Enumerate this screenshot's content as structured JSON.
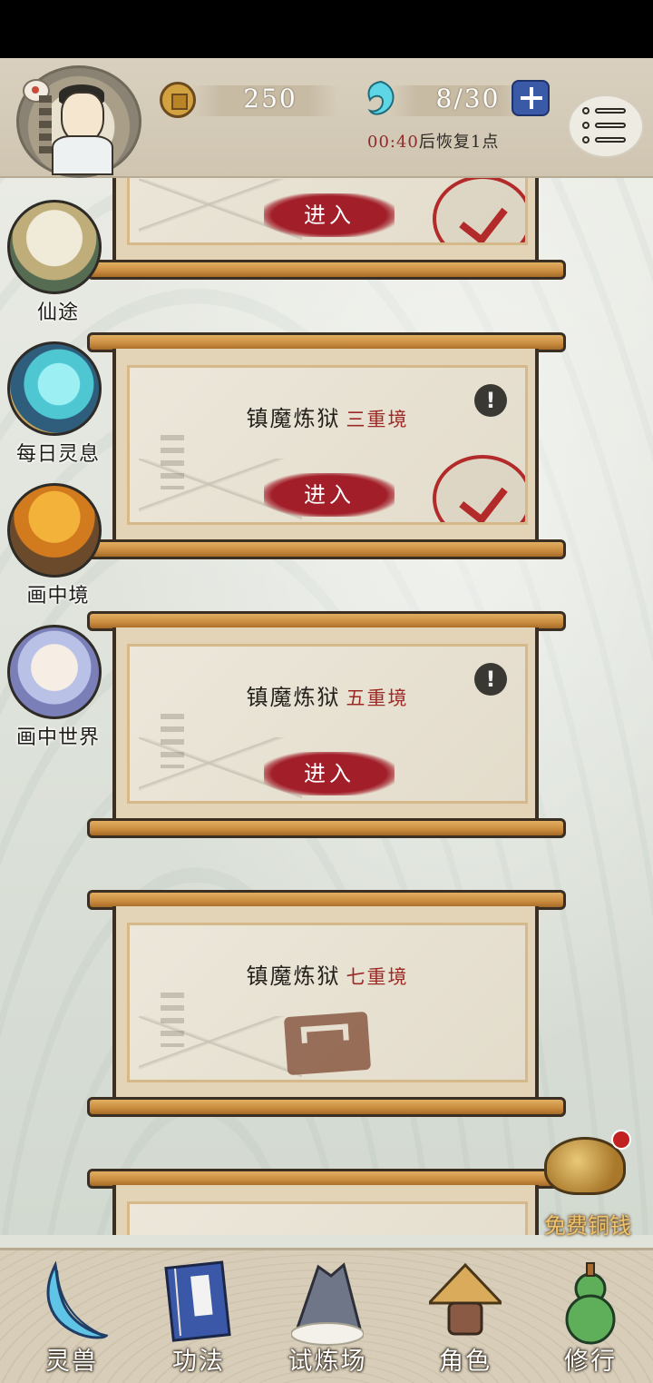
{
  "topbar": {
    "coins": "250",
    "stamina": "8/30",
    "recover_timer": "00:40",
    "recover_suffix": "后恢复1点"
  },
  "side_menu": [
    {
      "label": "仙途",
      "icon": "pine-tree-icon"
    },
    {
      "label": "每日灵息",
      "icon": "spirit-cloud-icon"
    },
    {
      "label": "画中境",
      "icon": "autumn-pavilion-icon"
    },
    {
      "label": "画中世界",
      "icon": "fairy-girl-icon"
    }
  ],
  "stages": [
    {
      "name": "",
      "level": "",
      "button": "进入",
      "status": "completed"
    },
    {
      "name": "镇魔炼狱",
      "level": "三重境",
      "button": "进入",
      "status": "completed"
    },
    {
      "name": "镇魔炼狱",
      "level": "五重境",
      "button": "进入",
      "status": "available"
    },
    {
      "name": "镇魔炼狱",
      "level": "七重境",
      "button": "",
      "status": "locked"
    }
  ],
  "free_coins": {
    "label": "免费铜钱"
  },
  "bottom_nav": [
    {
      "label": "灵兽",
      "icon": "feather-icon"
    },
    {
      "label": "功法",
      "icon": "book-icon"
    },
    {
      "label": "试炼场",
      "icon": "mountain-icon"
    },
    {
      "label": "角色",
      "icon": "straw-hat-icon"
    },
    {
      "label": "修行",
      "icon": "gourd-icon"
    }
  ],
  "colors": {
    "enter_button": "#a21f2a",
    "level_text": "#9b2a26",
    "scroll_wood": "#c98b3e",
    "stamina_plus": "#3a5aa8"
  }
}
